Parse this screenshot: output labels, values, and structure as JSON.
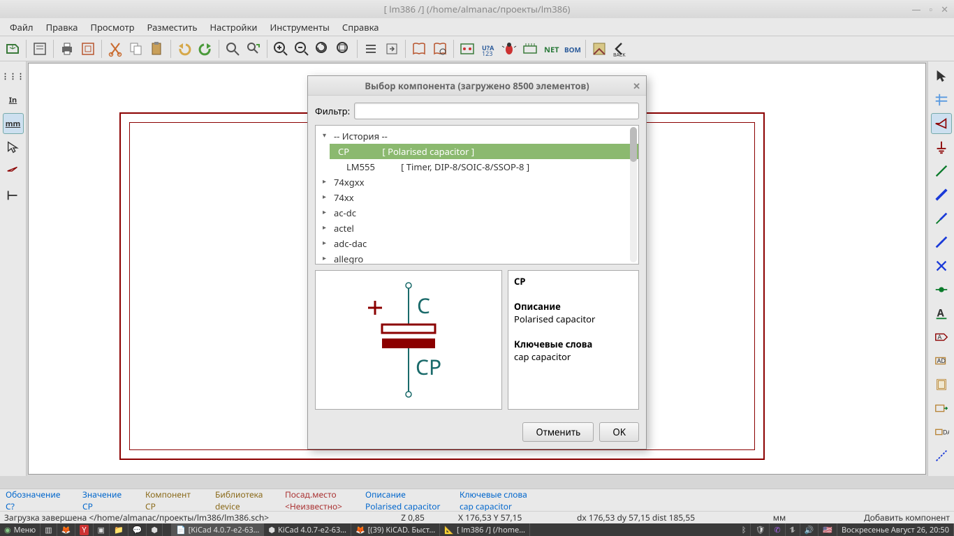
{
  "window": {
    "title": "[ lm386 /] (/home/almanac/проекты/lm386)"
  },
  "menu": [
    "Файл",
    "Правка",
    "Просмотр",
    "Разместить",
    "Настройки",
    "Инструменты",
    "Справка"
  ],
  "left_toolbar": {
    "grid": "⋮⋮⋮",
    "units_in": "In",
    "units_mm": "mm"
  },
  "dialog": {
    "title": "Выбор компонента (загружено 8500 элементов)",
    "filter_label": "Фильтр:",
    "filter_value": "",
    "history_header": "-- История --",
    "selected": {
      "name": "CP",
      "desc": "[ Polarised capacitor ]"
    },
    "history_item2": {
      "name": "LM555",
      "desc": "[ Timer, DIP-8/SOIC-8/SSOP-8 ]"
    },
    "libs": [
      "74xgxx",
      "74xx",
      "ac-dc",
      "actel",
      "adc-dac",
      "allegro"
    ],
    "info": {
      "name": "CP",
      "desc_label": "Описание",
      "desc_value": "Polarised capacitor",
      "kw_label": "Ключевые слова",
      "kw_value": "cap capacitor"
    },
    "preview": {
      "top_label": "C",
      "bottom_label": "CP"
    },
    "btn_cancel": "Отменить",
    "btn_ok": "OK"
  },
  "status_fields": {
    "designator_label": "Обозначение",
    "designator_value": "C?",
    "value_label": "Значение",
    "value_value": "CP",
    "component_label": "Компонент",
    "component_value": "CP",
    "library_label": "Библиотека",
    "library_value": "device",
    "footprint_label": "Посад.место",
    "footprint_value": "<Неизвестно>",
    "description_label": "Описание",
    "description_value": "Polarised capacitor",
    "keywords_label": "Ключевые слова",
    "keywords_value": "cap capacitor"
  },
  "statusbar": {
    "loaded": "Загрузка завершена </home/almanac/проекты/lm386/lm386.sch>",
    "zoom": "Z 0,85",
    "xy": "X 176,53  Y 57,15",
    "dxdy": "dx 176,53  dy 57,15  dist 185,55",
    "units": "мм",
    "mode": "Добавить компонент"
  },
  "taskbar": {
    "menu": "Меню",
    "items": [
      "[KiCad 4.0.7-e2-63…",
      "KiCad 4.0.7-e2-63…",
      "[(39) KiCAD. Быст…",
      "[ lm386 /] (/home…"
    ],
    "clock": "Воскресенье Август 26, 20:50"
  }
}
